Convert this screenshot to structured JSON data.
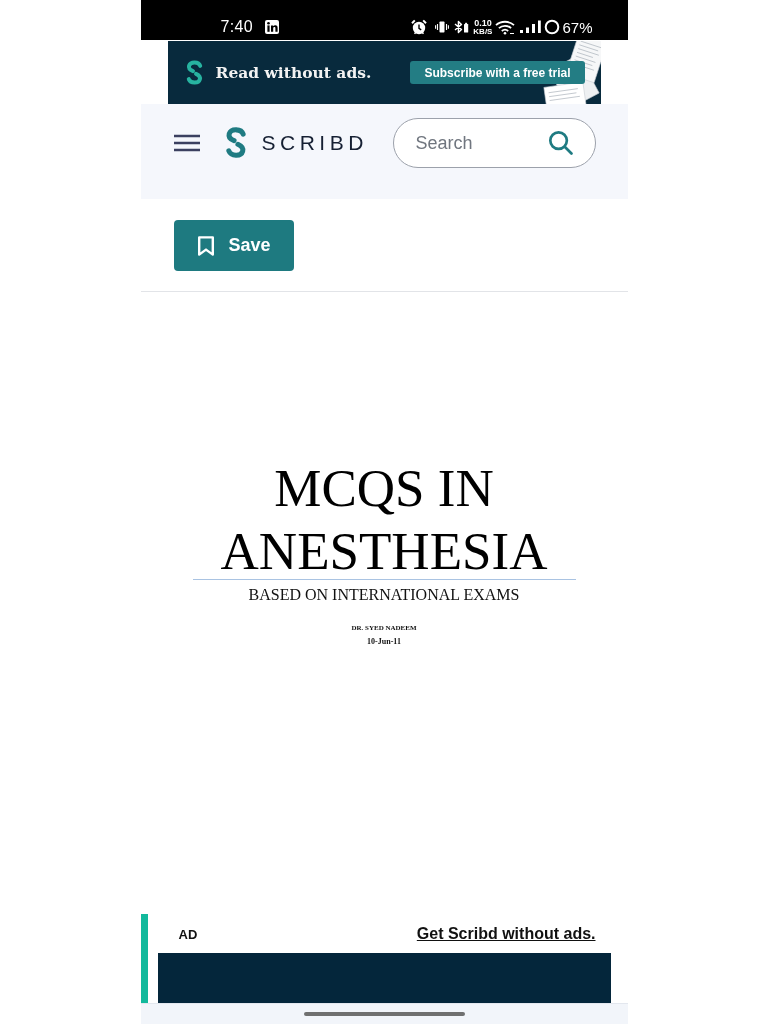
{
  "status_bar": {
    "time": "7:40",
    "data_rate": "0.10",
    "data_rate_unit": "KB/S",
    "battery": "67%"
  },
  "promo_banner": {
    "text": "Read without ads.",
    "button": "Subscribe with a free trial"
  },
  "header": {
    "logo_text": "SCRIBD",
    "search": {
      "placeholder": "Search"
    }
  },
  "toolbar": {
    "save_button": "Save"
  },
  "document": {
    "title": "MCQS IN ANESTHESIA",
    "subtitle": "BASED ON INTERNATIONAL EXAMS",
    "author": "DR. SYED NADEEM",
    "date": "10-Jun-11"
  },
  "ad": {
    "label": "AD",
    "link": "Get Scribd without ads."
  }
}
